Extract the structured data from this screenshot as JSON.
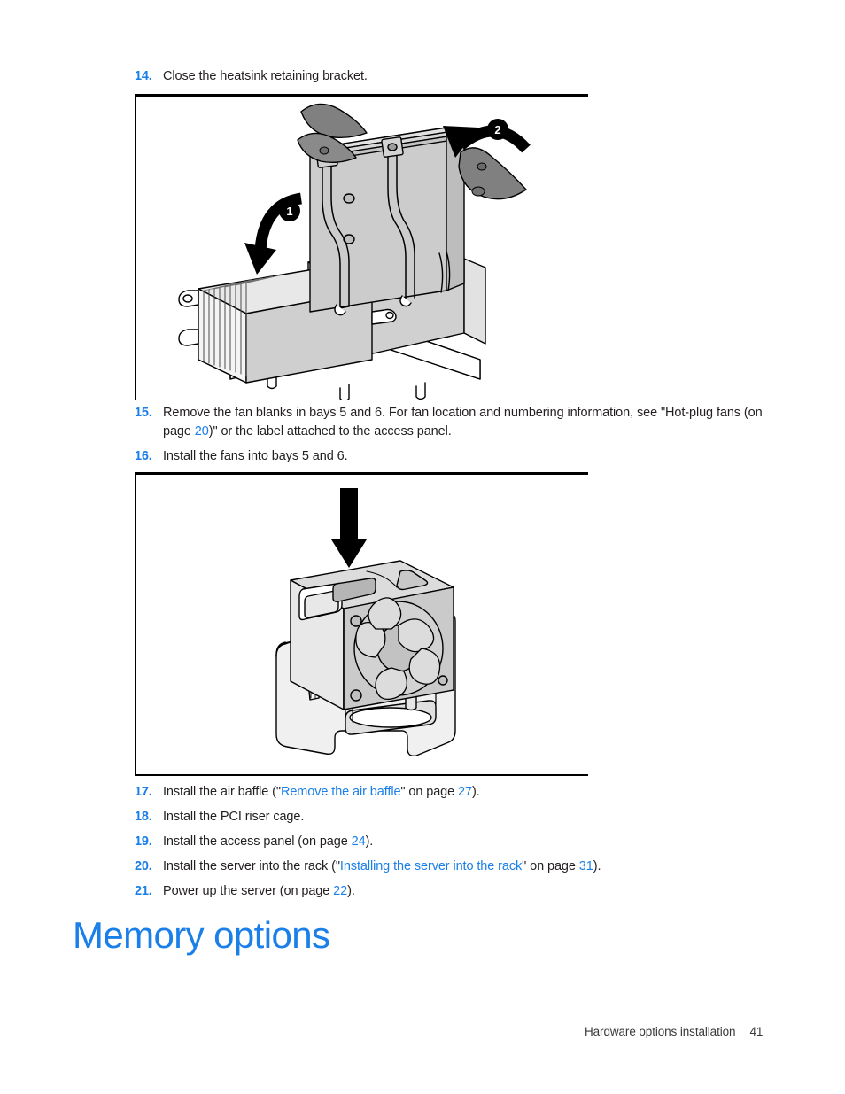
{
  "document": {
    "footer_title": "Hardware options installation",
    "page_number": "41"
  },
  "section_heading": "Memory options",
  "colors": {
    "link_blue": "#1a7fe8",
    "body_text": "#231f20",
    "rule_black": "#000000",
    "art_fill_light": "#d9d9d9",
    "art_fill_mid": "#a8a8a8",
    "art_fill_dark": "#808080"
  },
  "steps": [
    {
      "number": "14.",
      "parts": [
        {
          "type": "text",
          "value": "Close the heatsink retaining bracket."
        }
      ]
    },
    {
      "number": "15.",
      "parts": [
        {
          "type": "text",
          "value": "Remove the fan blanks in bays 5 and 6. For fan location and numbering information, see \"Hot-plug fans (on page "
        },
        {
          "type": "link",
          "value": "20"
        },
        {
          "type": "text",
          "value": ")\" or the label attached to the access panel."
        }
      ]
    },
    {
      "number": "16.",
      "parts": [
        {
          "type": "text",
          "value": "Install the fans into bays 5 and 6."
        }
      ]
    },
    {
      "number": "17.",
      "parts": [
        {
          "type": "text",
          "value": "Install the air baffle (\""
        },
        {
          "type": "link",
          "value": "Remove the air baffle"
        },
        {
          "type": "text",
          "value": "\" on page "
        },
        {
          "type": "link",
          "value": "27"
        },
        {
          "type": "text",
          "value": ")."
        }
      ]
    },
    {
      "number": "18.",
      "parts": [
        {
          "type": "text",
          "value": "Install the PCI riser cage."
        }
      ]
    },
    {
      "number": "19.",
      "parts": [
        {
          "type": "text",
          "value": "Install the access panel (on page "
        },
        {
          "type": "link",
          "value": "24"
        },
        {
          "type": "text",
          "value": ")."
        }
      ]
    },
    {
      "number": "20.",
      "parts": [
        {
          "type": "text",
          "value": "Install the server into the rack (\""
        },
        {
          "type": "link",
          "value": "Installing the server into the rack"
        },
        {
          "type": "text",
          "value": "\" on page "
        },
        {
          "type": "link",
          "value": "31"
        },
        {
          "type": "text",
          "value": ")."
        }
      ]
    },
    {
      "number": "21.",
      "parts": [
        {
          "type": "text",
          "value": "Power up the server (on page "
        },
        {
          "type": "link",
          "value": "22"
        },
        {
          "type": "text",
          "value": ")."
        }
      ]
    }
  ],
  "figures": [
    {
      "id": "heatsink-retaining-bracket",
      "caption_alt": "Heatsink retaining bracket being closed over two finned heatsinks",
      "callouts": [
        {
          "label": "1",
          "description": "rotate left bracket latch down"
        },
        {
          "label": "2",
          "description": "rotate right bracket latch down"
        }
      ]
    },
    {
      "id": "hot-plug-fan-install",
      "caption_alt": "Hot-plug fan module being lowered into the fan cage bay",
      "callouts": []
    }
  ]
}
